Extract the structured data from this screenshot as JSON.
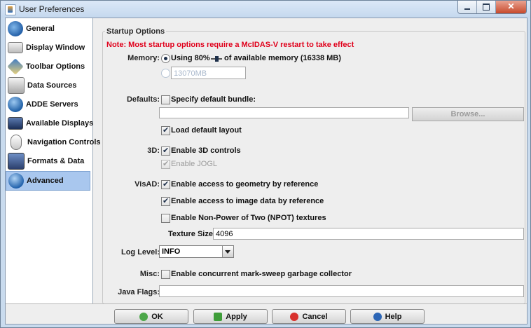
{
  "window": {
    "title": "User Preferences"
  },
  "sidebar": {
    "items": [
      {
        "label": "General",
        "icon": "globe-icon"
      },
      {
        "label": "Display Window",
        "icon": "window-icon"
      },
      {
        "label": "Toolbar Options",
        "icon": "toolbar-icon"
      },
      {
        "label": "Data Sources",
        "icon": "data-sources-icon"
      },
      {
        "label": "ADDE Servers",
        "icon": "server-globe-icon"
      },
      {
        "label": "Available Displays",
        "icon": "monitor-icon"
      },
      {
        "label": "Navigation Controls",
        "icon": "mouse-icon"
      },
      {
        "label": "Formats & Data",
        "icon": "formats-icon"
      },
      {
        "label": "Advanced",
        "icon": "globe-icon",
        "selected": true
      }
    ]
  },
  "startup": {
    "group_title": "Startup Options",
    "note": "Note: Most startup options require a McIDAS-V restart to take effect",
    "memory": {
      "label": "Memory:",
      "option_percent_pre": "Using 80%",
      "option_percent_post": "of available memory (16338 MB)",
      "option_custom_value": "13070MB",
      "selected": "percent"
    },
    "defaults": {
      "label": "Defaults:",
      "bundle_label": "Specify default bundle:",
      "bundle_checked": false,
      "bundle_path": "",
      "browse_label": "Browse...",
      "layout_label": "Load default layout",
      "layout_checked": true
    },
    "three_d": {
      "label": "3D:",
      "enable_3d_label": "Enable 3D controls",
      "enable_3d_checked": true,
      "enable_jogl_label": "Enable JOGL",
      "enable_jogl_checked": true
    },
    "visad": {
      "label": "VisAD:",
      "geometry_label": "Enable access to geometry by reference",
      "geometry_checked": true,
      "image_label": "Enable access to image data by reference",
      "image_checked": true,
      "npot_label": "Enable Non-Power of Two (NPOT) textures",
      "npot_checked": false,
      "texture_label": "Texture Size:",
      "texture_value": "4096"
    },
    "log_level": {
      "label": "Log Level:",
      "value": "INFO"
    },
    "misc": {
      "label": "Misc:",
      "gc_label": "Enable concurrent mark-sweep garbage collector",
      "gc_checked": false
    },
    "java_flags": {
      "label": "Java Flags:",
      "value": ""
    }
  },
  "footer": {
    "ok": "OK",
    "apply": "Apply",
    "cancel": "Cancel",
    "help": "Help"
  }
}
